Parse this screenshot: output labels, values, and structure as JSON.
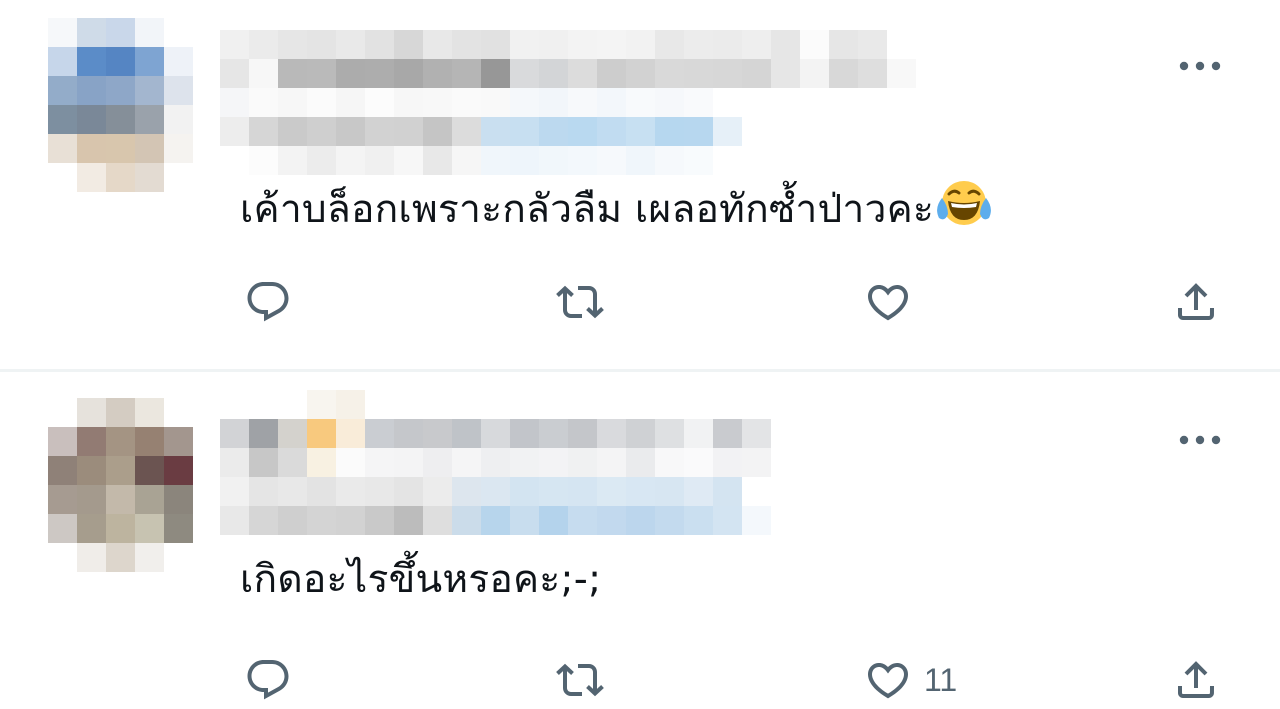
{
  "tweets": [
    {
      "text": "เค้าบล็อกเพราะกลัวลืม เผลอทักซ้ำป่าวคะ",
      "emoji": "face-with-tears-of-joy",
      "reply_count": "",
      "retweet_count": "",
      "like_count": ""
    },
    {
      "text": "เกิดอะไรขึ้นหรอคะ;-;",
      "emoji": "",
      "reply_count": "",
      "retweet_count": "",
      "like_count": "11"
    }
  ],
  "icons": {
    "reply": "reply-icon",
    "retweet": "retweet-icon",
    "like": "heart-icon",
    "share": "share-icon",
    "more": "more-options-icon"
  },
  "colors": {
    "icon": "#536471",
    "text": "#0f1419",
    "divider": "#eff3f4",
    "emoji_face": "#ffcc4d",
    "emoji_tears": "#5dadec"
  }
}
